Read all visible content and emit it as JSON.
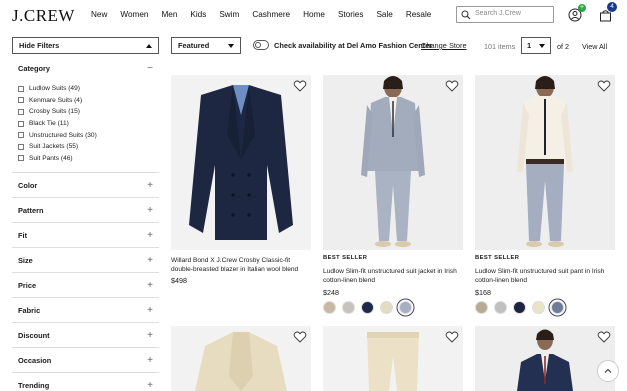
{
  "header": {
    "logo": "J.CREW",
    "nav": [
      "New",
      "Women",
      "Men",
      "Kids",
      "Swim",
      "Cashmere",
      "Home",
      "Stories",
      "Sale",
      "Resale"
    ],
    "search_placeholder": "Search J.Crew",
    "bag_count": "4",
    "user_badge": "+"
  },
  "toolbar": {
    "hide_filters": "Hide Filters",
    "sort": "Featured",
    "availability": "Check availability at Del Amo Fashion Center",
    "change_store": "Change Store",
    "items_count": "101 items",
    "page": "1",
    "of_pages": "of 2",
    "view_all": "View All"
  },
  "sidebar": {
    "category_title": "Category",
    "categories": [
      "Ludlow Suits (49)",
      "Kenmare Suits (4)",
      "Crosby Suits (15)",
      "Black Tie (11)",
      "Unstructured Suits (30)",
      "Suit Jackets (55)",
      "Suit Pants (46)"
    ],
    "sections": [
      "Color",
      "Pattern",
      "Fit",
      "Size",
      "Price",
      "Fabric",
      "Discount",
      "Occasion",
      "Trending"
    ]
  },
  "products": [
    {
      "badge": "",
      "name": "Willard Bond X J.Crew Crosby Classic-fit double-breasted blazer in Italian wool blend",
      "price": "$498",
      "swatches": []
    },
    {
      "badge": "BEST SELLER",
      "name": "Ludlow Slim-fit unstructured suit jacket in Irish cotton-linen blend",
      "price": "$248",
      "swatches": [
        "#c9b8a2",
        "#c7c2bb",
        "#1f2a4a",
        "#e3dcc3",
        "#a6b0c2"
      ]
    },
    {
      "badge": "BEST SELLER",
      "name": "Ludlow Slim-fit unstructured suit pant in Irish cotton-linen blend",
      "price": "$168",
      "swatches": [
        "#b8ab93",
        "#bfc0bf",
        "#1c2440",
        "#ebe3c6",
        "#6f7d9c"
      ]
    }
  ],
  "colors": {
    "accent_green": "#2aa847",
    "accent_navy": "#1a3a8c"
  }
}
